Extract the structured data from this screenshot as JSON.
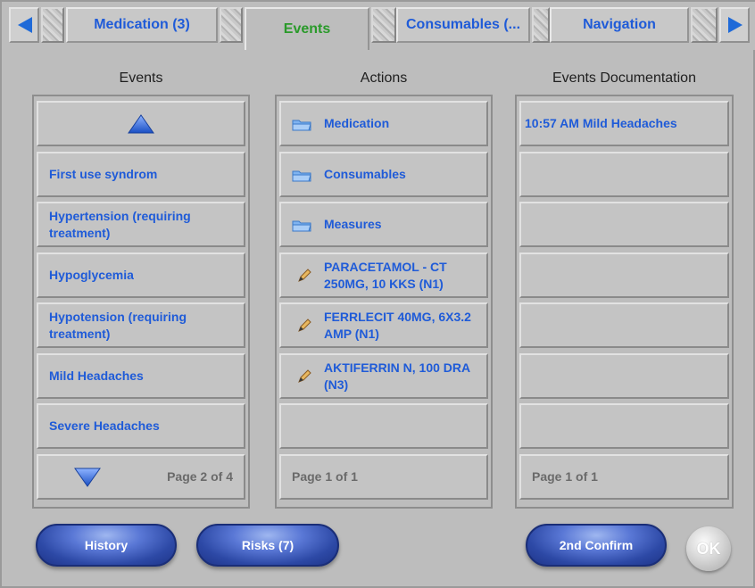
{
  "tabs": [
    {
      "label": "Medication (3)",
      "active": false
    },
    {
      "label": "Events",
      "active": true
    },
    {
      "label": "Consumables (...",
      "active": false
    },
    {
      "label": "Navigation",
      "active": false
    }
  ],
  "columns": {
    "events": {
      "title": "Events",
      "items": [
        "First use syndrom",
        "Hypertension (requiring treatment)",
        "Hypoglycemia",
        "Hypotension (requiring treatment)",
        "Mild Headaches",
        "Severe Headaches"
      ],
      "pager": "Page 2 of 4"
    },
    "actions": {
      "title": "Actions",
      "folders": [
        "Medication",
        "Consumables",
        "Measures"
      ],
      "items": [
        "PARACETAMOL - CT 250MG, 10 KKS (N1)",
        "FERRLECIT 40MG, 6X3.2 AMP (N1)",
        "AKTIFERRIN N, 100 DRA (N3)"
      ],
      "pager": "Page 1 of 1"
    },
    "documentation": {
      "title": "Events Documentation",
      "items": [
        "10:57 AM Mild Headaches"
      ],
      "pager": "Page 1 of 1"
    }
  },
  "buttons": {
    "history": "History",
    "risks": "Risks (7)",
    "second_confirm": "2nd Confirm",
    "ok": "OK"
  },
  "icons": {
    "tab_prev": "left-arrow-icon",
    "tab_next": "right-arrow-icon",
    "page_up": "up-triangle-icon",
    "page_down": "down-triangle-icon",
    "folder": "folder-icon",
    "pencil": "pencil-icon"
  },
  "colors": {
    "accent_blue": "#1f5bd8",
    "active_tab_green": "#2a9a2a",
    "background": "#bdbdbd"
  }
}
